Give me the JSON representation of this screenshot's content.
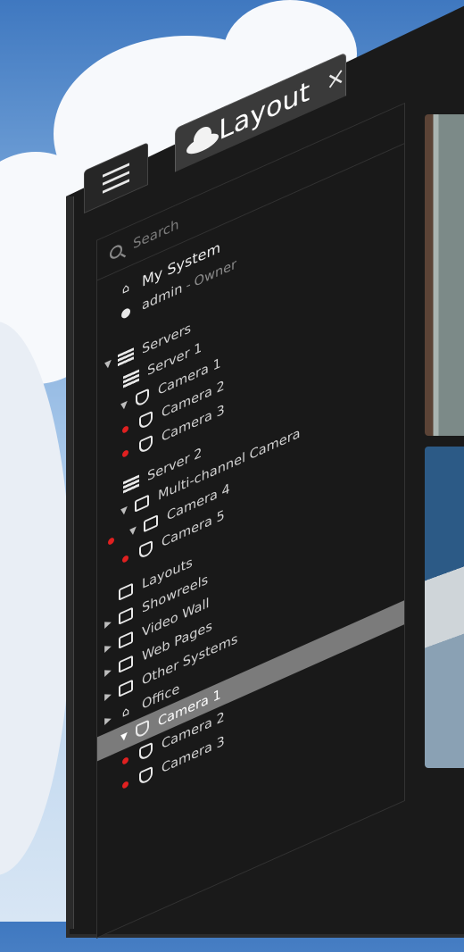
{
  "tab": {
    "label": "Layout",
    "close": "×",
    "icon": "cloud-icon"
  },
  "menu": {
    "icon": "hamburger-icon"
  },
  "search": {
    "placeholder": "Search"
  },
  "system": {
    "name": "My System",
    "user": "admin",
    "separator": "-",
    "role": "Owner"
  },
  "tree": {
    "servers": "Servers",
    "server1": {
      "label": "Server 1",
      "cameras": [
        "Camera 1",
        "Camera 2",
        "Camera 3"
      ]
    },
    "server2": {
      "label": "Server 2",
      "multichannel": "Multi-channel Camera",
      "cameras": [
        "Camera 4",
        "Camera 5"
      ]
    },
    "groups": [
      "Layouts",
      "Showreels",
      "Video Wall",
      "Web Pages",
      "Other Systems"
    ],
    "office": {
      "label": "Office",
      "cameras": [
        "Camera 1",
        "Camera 2",
        "Camera 3"
      ]
    }
  },
  "colors": {
    "accent_red": "#e02020",
    "highlight": "#7b7b7b",
    "panel": "#191919"
  }
}
